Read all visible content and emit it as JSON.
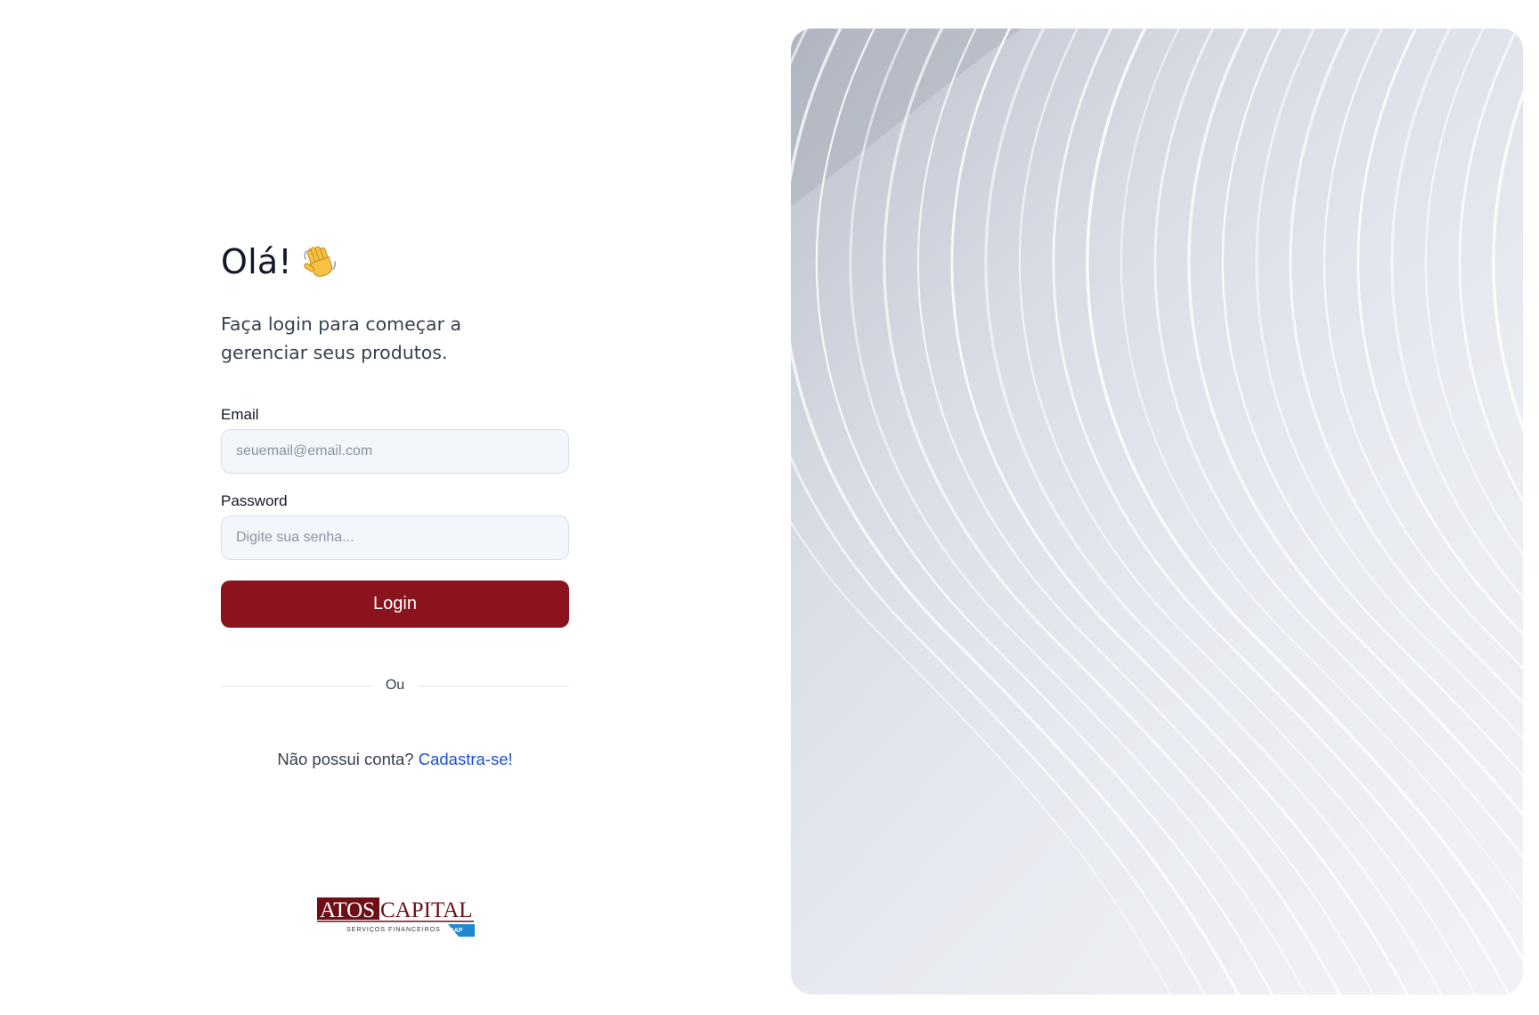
{
  "greeting": {
    "title": "Olá!",
    "emoji": "👋"
  },
  "subtitle": "Faça login para começar a gerenciar seus produtos.",
  "form": {
    "email_label": "Email",
    "email_placeholder": "seuemail@email.com",
    "email_value": "",
    "password_label": "Password",
    "password_placeholder": "Digite sua senha...",
    "password_value": "",
    "login_label": "Login"
  },
  "divider": {
    "label": "Ou"
  },
  "signup": {
    "text": "Não possui conta?",
    "link": "Cadastra-se!"
  },
  "logo": {
    "name_part1": "ATOS",
    "name_part2": "CAPITAL",
    "tagline": "SERVIÇOS FINANCEIROS",
    "badge": "SAP"
  },
  "colors": {
    "primary": "#8a131d",
    "link": "#1d4ed8",
    "input_bg": "#f3f6fa",
    "input_border": "#d7dee8"
  }
}
